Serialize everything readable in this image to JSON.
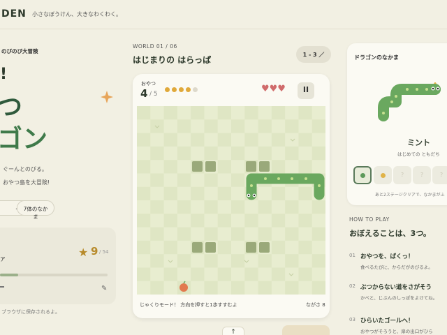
{
  "header": {
    "brand": "DEN",
    "tagline": "小さなぼうけん、大きなわくわく。"
  },
  "hero": {
    "kicker": "のびのび大冒険",
    "line_excl": "!",
    "line1": "つ",
    "line2": "ゴン",
    "desc1": "ぐーんとのびる。",
    "desc2": "おやつ島を大冒険!",
    "pill_stage": "ージ",
    "pill_friends": "7体のなかま"
  },
  "progress": {
    "label": "ア",
    "star_count": "9",
    "star_total": "/ 54",
    "bar_fraction": 0.167,
    "save_note": "ブラウザに保存されるよ。"
  },
  "level": {
    "world_label": "WORLD 01 / 06",
    "title": "はじまりの はらっぱ",
    "stage_pill": "1 - 3 ／"
  },
  "game": {
    "snack_label": "おやつ",
    "snack_count": "4",
    "snack_total": "/ 5",
    "snack_eaten": 4,
    "snack_max": 5,
    "hearts": "♥♥♥",
    "pause_icon": "II",
    "mode_text": "じゃくりモード！ 方向を押すと1歩すすむよ",
    "length_text": "ながさ 8",
    "dpad_up": "↑"
  },
  "friends": {
    "title": "ドラゴンのなかま",
    "name": "ミント",
    "desc": "はじめての ともだち",
    "slot_colors": [
      "#5d9a5a",
      "#e0b348"
    ],
    "unlock_note": "あと2ステージクリアで、なかまがふ"
  },
  "howto": {
    "label": "HOW TO PLAY",
    "title": "おぼえることは、3つ。",
    "steps": [
      {
        "num": "01",
        "title": "おやつを、ぱくっ！",
        "desc": "食べるたびに、からだがのびるよ。"
      },
      {
        "num": "02",
        "title": "ぶつからない道をさがそう",
        "desc": "かべと、じぶんのしっぽをよけてね。"
      },
      {
        "num": "03",
        "title": "ひらいたゴールへ！",
        "desc": "おやつがそろうと、扉の出口がひら"
      }
    ]
  },
  "colors": {
    "accent_green": "#3f7a4a",
    "snake_green": "#6aa85f",
    "snack_gold": "#e0a93a",
    "heart_red": "#d06b6b",
    "star_gold": "#b78a2a"
  }
}
